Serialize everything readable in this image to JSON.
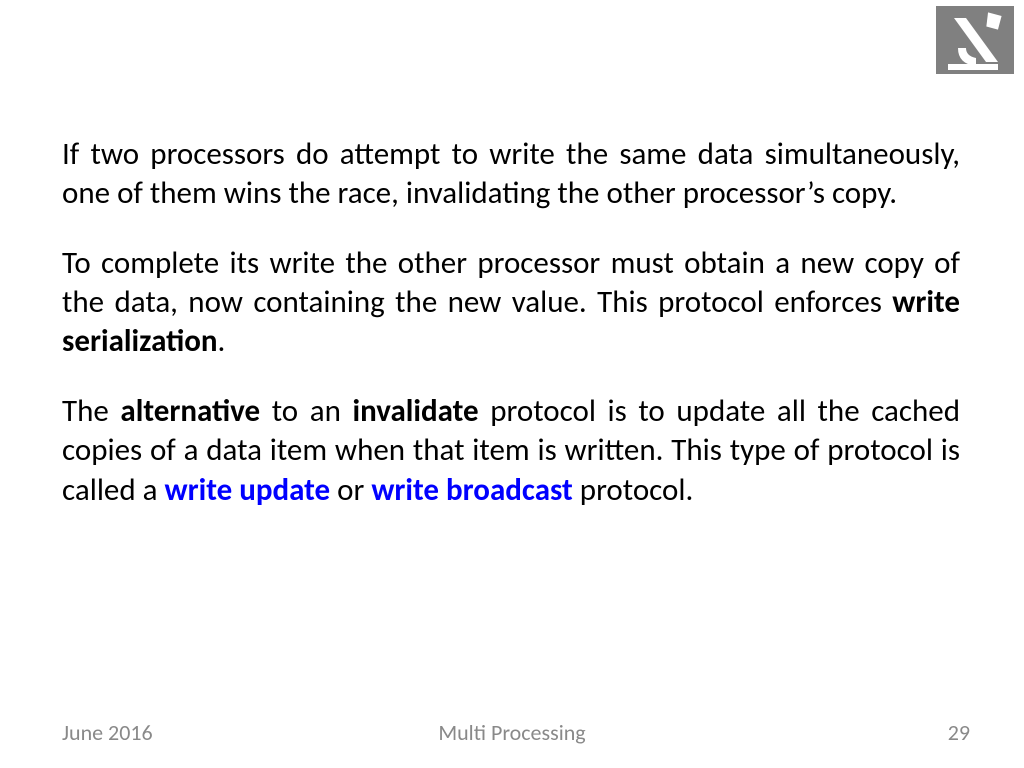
{
  "para1": "If two processors do attempt to write the same data simultaneously, one of them wins the race, invalidating the other processor’s copy.",
  "para2": {
    "t1": "To complete its write the other processor must obtain a new copy of the data, now containing the new value. This protocol enforces ",
    "b1": "write serialization",
    "t2": "."
  },
  "para3": {
    "t1": "The ",
    "b1": "alternative",
    "t2": " to an ",
    "b2": "invalidate",
    "t3": " protocol is to update all the cached copies of a data item when that item is written. This type of protocol is called a ",
    "blue1": "write update",
    "t4": " or ",
    "blue2": "write broadcast",
    "t5": " protocol."
  },
  "footer": {
    "date": "June 2016",
    "title": "Multi Processing",
    "page": "29"
  }
}
